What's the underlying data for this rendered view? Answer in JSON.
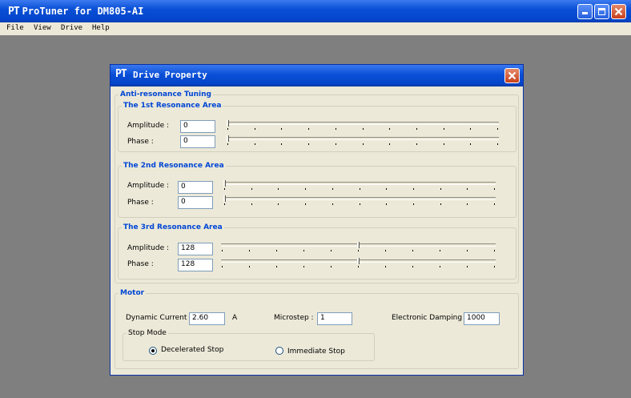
{
  "app": {
    "title": "ProTuner for DM805-AI",
    "logo": "PT"
  },
  "menu": [
    "File",
    "View",
    "Drive",
    "Help"
  ],
  "dialog": {
    "logo": "PT",
    "title": "Drive Property",
    "tuning": {
      "label": "Anti-resonance Tuning",
      "areas": [
        {
          "label": "The 1st Resonance Area",
          "amplitude_label": "Amplitude :",
          "phase_label": "Phase :",
          "amplitude": "0",
          "phase": "0",
          "amplitude_level": 0,
          "phase_level": 0
        },
        {
          "label": "The 2nd Resonance Area",
          "amplitude_label": "Amplitude :",
          "phase_label": "Phase :",
          "amplitude": "0",
          "phase": "0",
          "amplitude_level": 0,
          "phase_level": 0
        },
        {
          "label": "The 3rd Resonance Area",
          "amplitude_label": "Amplitude :",
          "phase_label": "Phase :",
          "amplitude": "128",
          "phase": "128",
          "amplitude_level": 0.5,
          "phase_level": 0.5
        }
      ]
    },
    "motor": {
      "label": "Motor",
      "current_label": "Dynamic Current :",
      "current": "2.60",
      "current_unit": "A",
      "microstep_label": "Microstep :",
      "microstep": "1",
      "damping_label": "Electronic Damping :",
      "damping": "1000",
      "stop_mode": {
        "label": "Stop Mode",
        "options": [
          "Decelerated Stop",
          "Immediate Stop"
        ],
        "selected": "Decelerated Stop"
      }
    }
  },
  "colors": {
    "title_blue": "#0a4fd6",
    "group_label": "#0046d5",
    "face": "#ece9d8",
    "desktop": "#7f7f7f"
  }
}
